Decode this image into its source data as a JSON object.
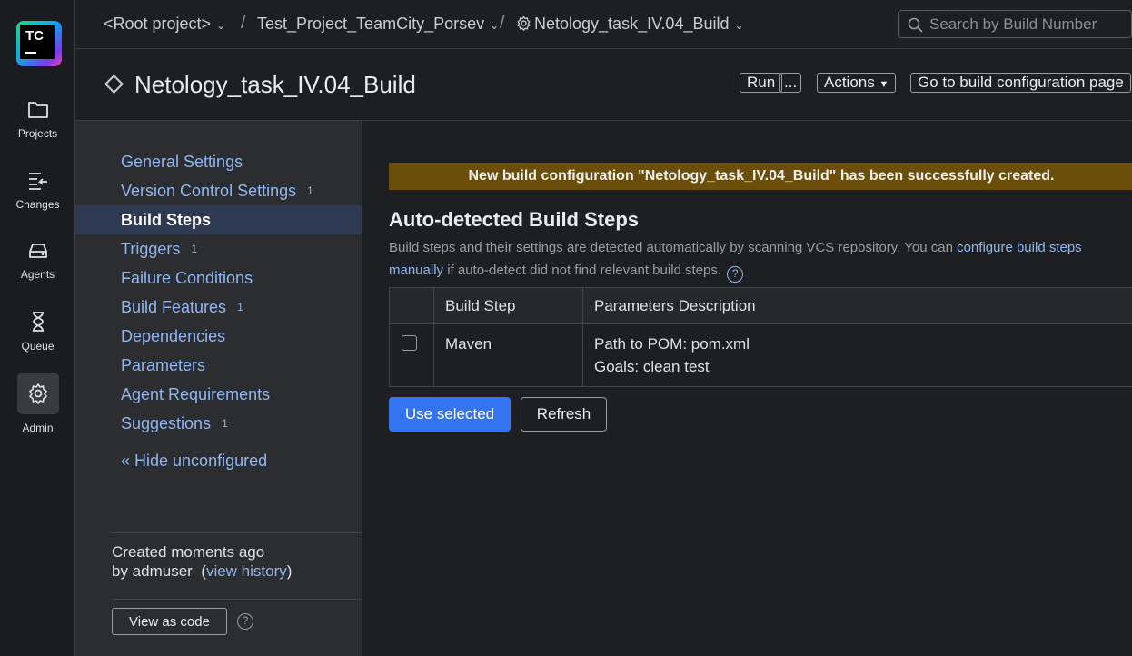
{
  "app": {
    "logo_text": "TC"
  },
  "nav": [
    {
      "label": "Projects",
      "icon": "folder-icon"
    },
    {
      "label": "Changes",
      "icon": "changes-icon"
    },
    {
      "label": "Agents",
      "icon": "agents-icon"
    },
    {
      "label": "Queue",
      "icon": "hourglass-icon"
    },
    {
      "label": "Admin",
      "icon": "gear-icon",
      "active": true
    }
  ],
  "breadcrumb": {
    "root": "<Root project>",
    "project": "Test_Project_TeamCity_Porsev",
    "config": "Netology_task_IV.04_Build",
    "separator": "/"
  },
  "search": {
    "placeholder": "Search by Build Number"
  },
  "header": {
    "title": "Netology_task_IV.04_Build",
    "run_label": "Run",
    "run_more_label": "...",
    "actions_label": "Actions",
    "goto_label": "Go to build configuration page"
  },
  "sidebar": {
    "items": [
      {
        "label": "General Settings",
        "badge": ""
      },
      {
        "label": "Version Control Settings",
        "badge": "1"
      },
      {
        "label": "Build Steps",
        "badge": "",
        "active": true
      },
      {
        "label": "Triggers",
        "badge": "1"
      },
      {
        "label": "Failure Conditions",
        "badge": ""
      },
      {
        "label": "Build Features",
        "badge": "1"
      },
      {
        "label": "Dependencies",
        "badge": ""
      },
      {
        "label": "Parameters",
        "badge": ""
      },
      {
        "label": "Agent Requirements",
        "badge": ""
      },
      {
        "label": "Suggestions",
        "badge": "1"
      }
    ],
    "hide_unconfigured": "« Hide unconfigured",
    "created_line1": "Created moments ago",
    "created_by": "by admuser",
    "created_open": "(",
    "view_history": "view history",
    "created_close": ")",
    "view_as_code": "View as code",
    "help": "?"
  },
  "main": {
    "banner": "New build configuration \"Netology_task_IV.04_Build\" has been successfully created.",
    "heading": "Auto-detected Build Steps",
    "desc_before": "Build steps and their settings are detected automatically by scanning VCS repository. You can ",
    "desc_link": "configure build steps manually",
    "desc_after": " if auto-detect did not find relevant build steps.",
    "help": "?",
    "table": {
      "columns": [
        "",
        "Build Step",
        "Parameters Description"
      ],
      "rows": [
        {
          "checked": false,
          "step": "Maven",
          "param_line1": "Path to POM: pom.xml",
          "param_line2": "Goals: clean test"
        }
      ]
    },
    "use_selected_label": "Use selected",
    "refresh_label": "Refresh"
  },
  "colors": {
    "accent": "#3574f0",
    "banner_bg": "#6b4e0a",
    "link": "#8fb6f0",
    "active_item_bg": "#2e3a52"
  }
}
